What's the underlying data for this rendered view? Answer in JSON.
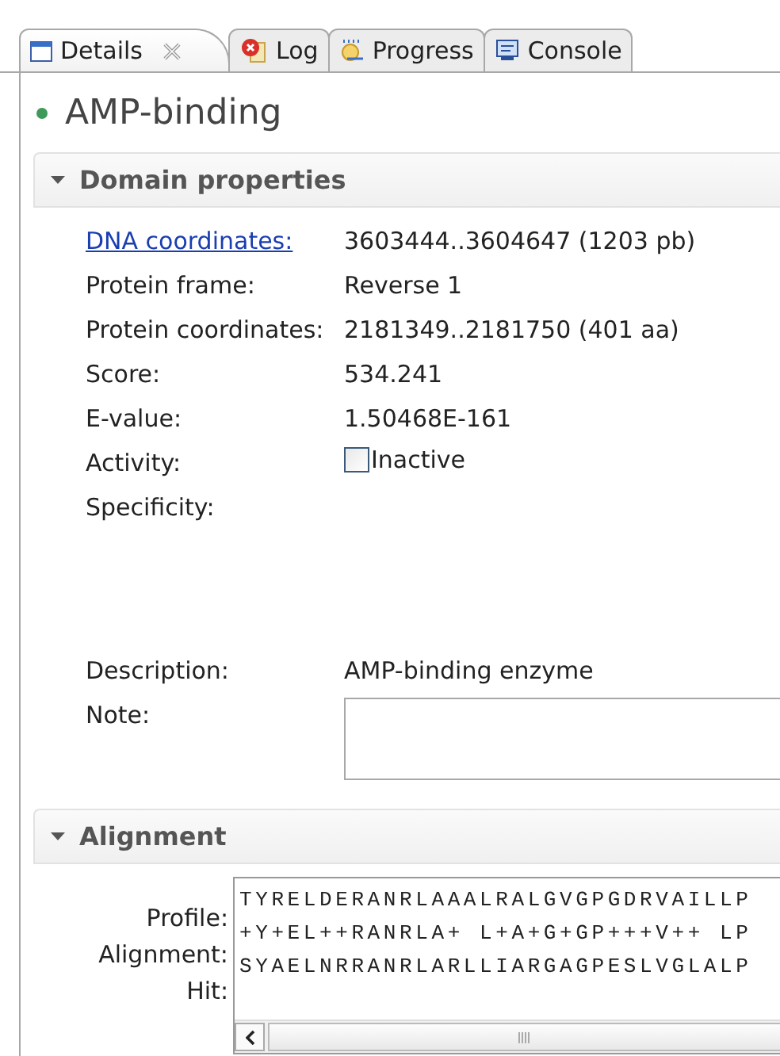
{
  "tabs": [
    {
      "label": "Details",
      "selected": true,
      "closable": true
    },
    {
      "label": "Log",
      "selected": false,
      "closable": false
    },
    {
      "label": "Progress",
      "selected": false,
      "closable": false
    },
    {
      "label": "Console",
      "selected": false,
      "closable": false
    }
  ],
  "title": "AMP-binding",
  "sections": [
    {
      "kind": "properties",
      "title": "Domain properties",
      "expanded": true,
      "properties": [
        {
          "kind": "link",
          "label": "DNA coordinates:",
          "value": "3603444..3604647 (1203 pb)"
        },
        {
          "kind": "text",
          "label": "Protein frame:",
          "value": "Reverse 1"
        },
        {
          "kind": "text",
          "label": "Protein coordinates:",
          "value": "2181349..2181750 (401 aa)"
        },
        {
          "kind": "text",
          "label": "Score:",
          "value": "534.241"
        },
        {
          "kind": "text",
          "label": "E-value:",
          "value": "1.50468E-161"
        },
        {
          "kind": "checkbox",
          "label": "Activity:",
          "value": "Inactive",
          "checked": false
        },
        {
          "kind": "blank",
          "label": "Specificity:"
        },
        {
          "kind": "text",
          "label": "Description:",
          "value": "AMP-binding enzyme"
        },
        {
          "kind": "textarea",
          "label": "Note:"
        }
      ]
    },
    {
      "kind": "alignment",
      "title": "Alignment",
      "expanded": true,
      "labels": [
        "Profile:",
        "Alignment:",
        "Hit:"
      ],
      "lines": [
        "TYRELDERANRLAAALRALGVGPGDRVAILLP",
        "+Y+EL++RANRLA+ L+A+G+GP+++V++ LP",
        "SYAELNRRANRLARLLIARGAGPESLVGLALP"
      ]
    }
  ]
}
